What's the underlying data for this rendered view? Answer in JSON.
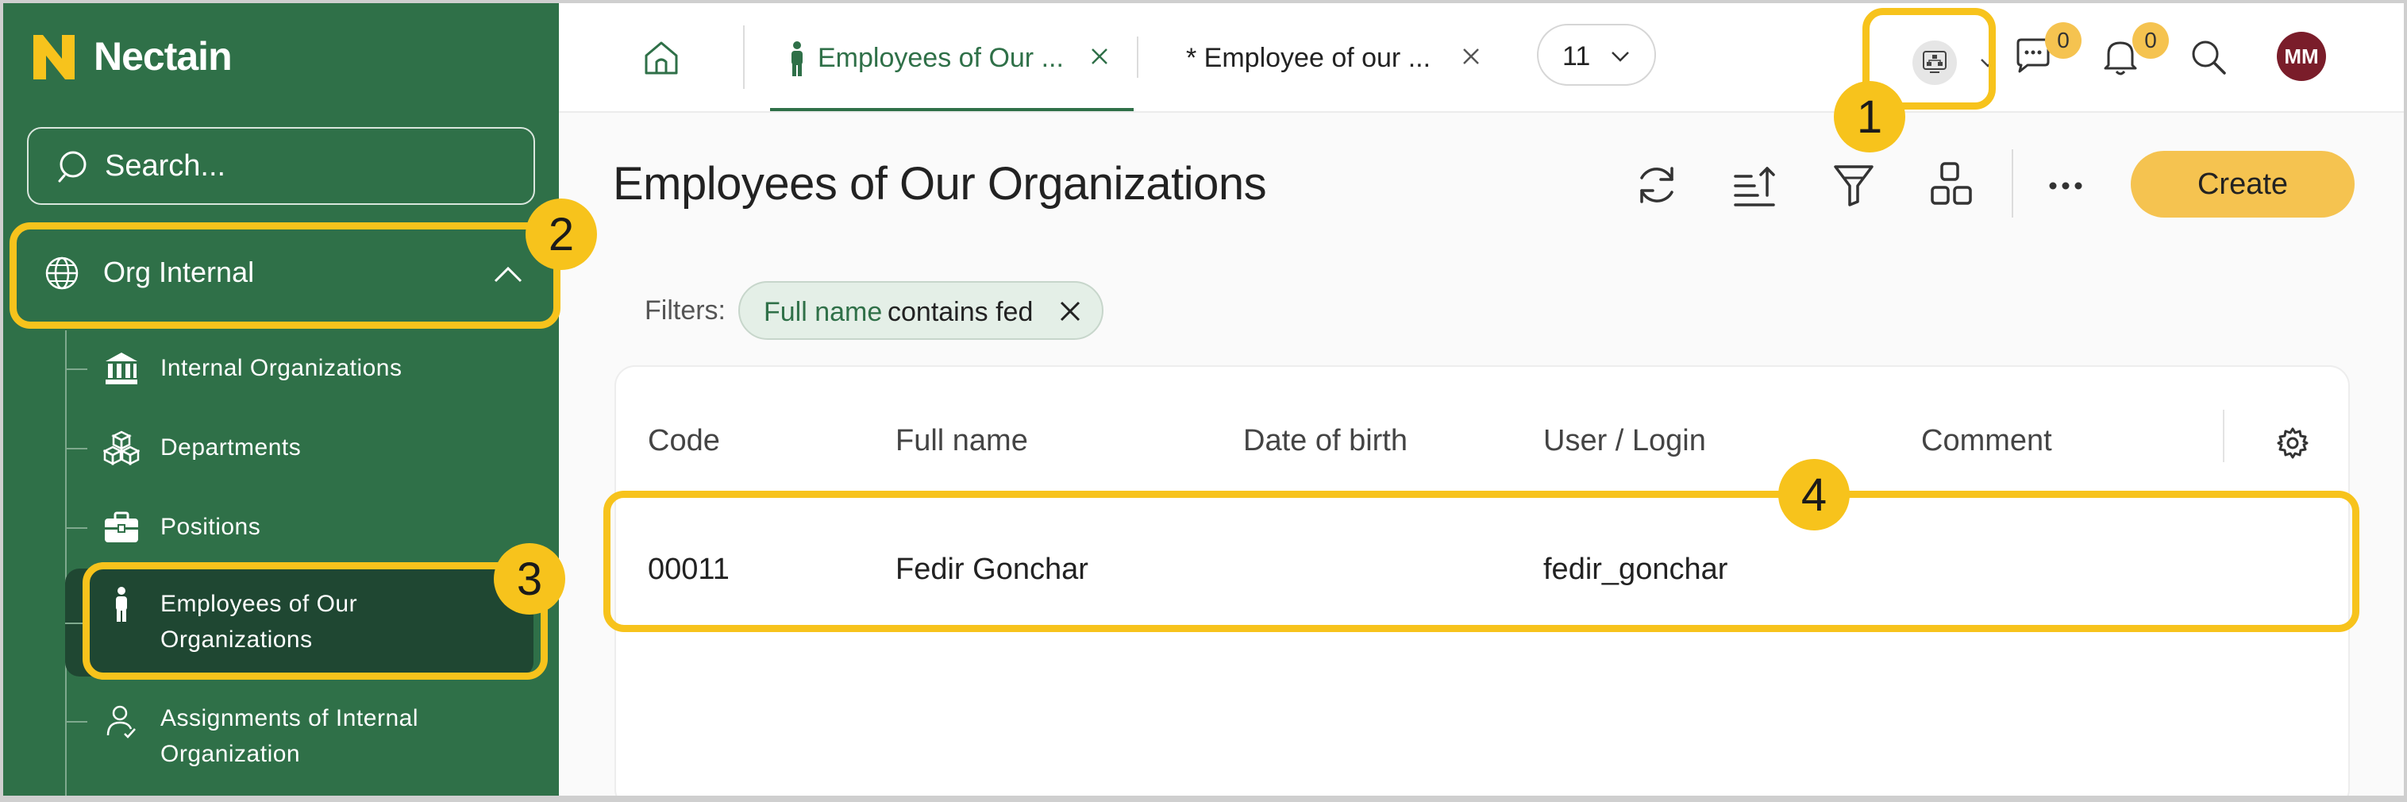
{
  "app": {
    "name": "Nectain"
  },
  "sidebar": {
    "search": {
      "placeholder": "Search..."
    },
    "group": {
      "label": "Org Internal"
    },
    "items": [
      {
        "label": "Internal Organizations",
        "icon": "bank-icon"
      },
      {
        "label": "Departments",
        "icon": "cubes-icon"
      },
      {
        "label": "Positions",
        "icon": "briefcase-icon"
      },
      {
        "label": "Employees of Our Organizations",
        "icon": "person-icon"
      },
      {
        "label": "Assignments of Internal Organization",
        "icon": "user-assign-icon"
      }
    ]
  },
  "topbar": {
    "tabs": [
      {
        "label": "Employees of Our ...",
        "active": true
      },
      {
        "label": "* Employee of our ...",
        "active": false
      }
    ],
    "open_tabs_count": "11",
    "chat_count": "0",
    "notification_count": "0",
    "user_initials": "MM"
  },
  "page": {
    "title": "Employees of Our Organizations",
    "create_label": "Create",
    "filters_label": "Filters:",
    "filter": {
      "field": "Full name",
      "condition": "contains fed"
    }
  },
  "table": {
    "columns": [
      "Code",
      "Full name",
      "Date of birth",
      "User / Login",
      "Comment"
    ],
    "rows": [
      {
        "code": "00011",
        "full_name": "Fedir Gonchar",
        "date_of_birth": "",
        "login": "fedir_gonchar",
        "comment": ""
      }
    ]
  },
  "callouts": [
    "1",
    "2",
    "3",
    "4"
  ],
  "colors": {
    "sidebar": "#2f7048",
    "sidebar_selected": "#1f4732",
    "accent": "#f5c350",
    "highlight": "#f7c31c",
    "avatar": "#7a1d2a"
  }
}
